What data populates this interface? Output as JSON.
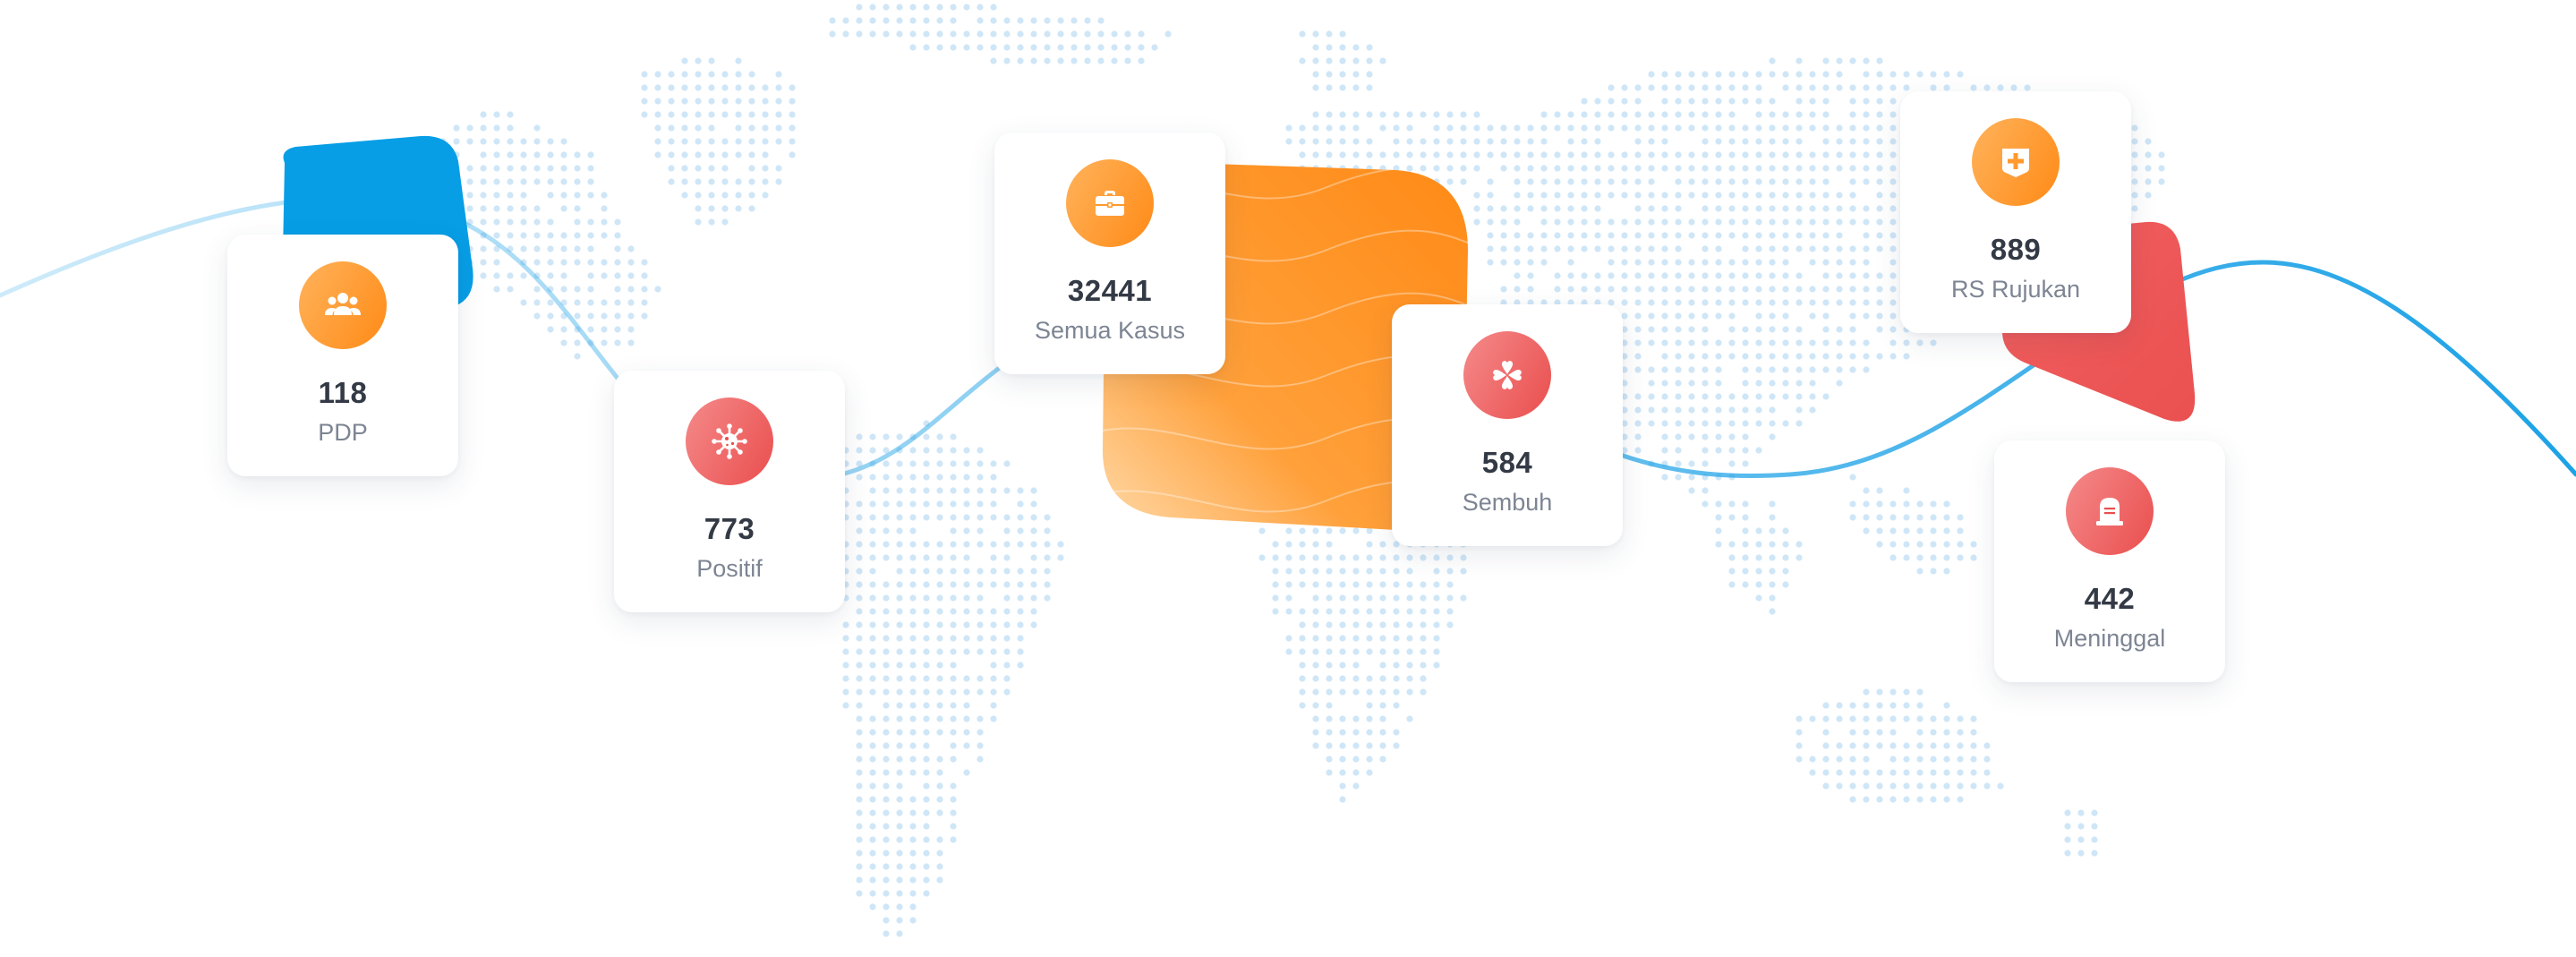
{
  "stats": {
    "pdp": {
      "value": "118",
      "label": "PDP",
      "icon": "people-icon"
    },
    "positif": {
      "value": "773",
      "label": "Positif",
      "icon": "virus-icon"
    },
    "semua_kasus": {
      "value": "32441",
      "label": "Semua Kasus",
      "icon": "briefcase-icon"
    },
    "sembuh": {
      "value": "584",
      "label": "Sembuh",
      "icon": "clover-icon"
    },
    "rs_rujukan": {
      "value": "889",
      "label": "RS Rujukan",
      "icon": "hospital-plus-icon"
    },
    "meninggal": {
      "value": "442",
      "label": "Meninggal",
      "icon": "tombstone-icon"
    }
  },
  "colors": {
    "orange_start": "#ffb35c",
    "orange_end": "#ff8a16",
    "red_start": "#f58a8a",
    "red_end": "#ea4e4e",
    "blue": "#079ee6",
    "line_blue": "#1da2e6",
    "map_dots": "#cfe6f7",
    "number_text": "#333a45",
    "label_text": "#7d8593"
  }
}
